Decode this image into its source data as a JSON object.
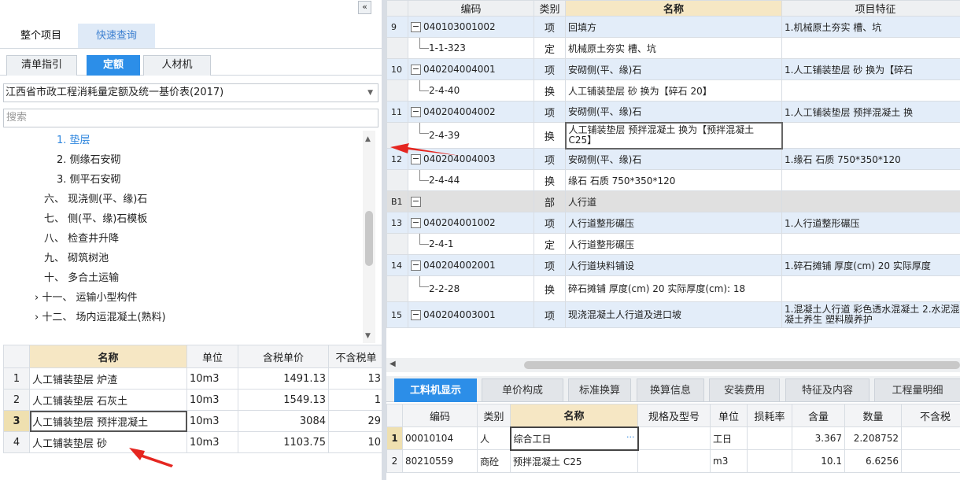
{
  "left_panel": {
    "collapse_glyph": "«",
    "project_tabs": [
      "整个项目",
      "快速查询"
    ],
    "sub_tabs": [
      "清单指引",
      "定额",
      "人材机"
    ],
    "quota_book": "江西省市政工程消耗量定额及统一基价表(2017)",
    "search_placeholder": "搜索",
    "tree": [
      {
        "label": "1. 垫层",
        "indent": 68,
        "selected": true
      },
      {
        "label": "2. 侧缘石安砌",
        "indent": 68
      },
      {
        "label": "3. 侧平石安砌",
        "indent": 68
      },
      {
        "label": "六、 现浇侧(平、缘)石",
        "indent": 52
      },
      {
        "label": "七、 侧(平、缘)石模板",
        "indent": 52
      },
      {
        "label": "八、 检查井升降",
        "indent": 52
      },
      {
        "label": "九、 砌筑树池",
        "indent": 52
      },
      {
        "label": "十、 多合土运输",
        "indent": 52
      },
      {
        "label": "› 十一、 运输小型构件",
        "indent": 40
      },
      {
        "label": "› 十二、 场内运混凝土(熟料)",
        "indent": 40
      }
    ],
    "quota_table": {
      "headers": [
        "名称",
        "单位",
        "含税单价",
        "不含税单"
      ],
      "rows": [
        {
          "no": "1",
          "name": "人工铺装垫层 炉渣",
          "unit": "10m3",
          "price": "1491.13",
          "ex": "13"
        },
        {
          "no": "2",
          "name": "人工铺装垫层 石灰土",
          "unit": "10m3",
          "price": "1549.13",
          "ex": "1"
        },
        {
          "no": "3",
          "name": "人工铺装垫层 预拌混凝土",
          "unit": "10m3",
          "price": "3084",
          "ex": "29"
        },
        {
          "no": "4",
          "name": "人工铺装垫层 砂",
          "unit": "10m3",
          "price": "1103.75",
          "ex": "10"
        }
      ]
    }
  },
  "grid": {
    "headers": [
      "编码",
      "类别",
      "名称",
      "项目特征"
    ],
    "rows": [
      {
        "no": "9",
        "code": "040103001002",
        "type": "项",
        "name": "回填方",
        "feature": "1.机械原土夯实 槽、坑",
        "kind": "xm"
      },
      {
        "no": "",
        "code": "1-1-323",
        "type": "定",
        "name": "机械原土夯实 槽、坑",
        "feature": "",
        "kind": "child"
      },
      {
        "no": "10",
        "code": "040204004001",
        "type": "项",
        "name": "安砌侧(平、缘)石",
        "feature": "1.人工铺装垫层 砂 换为【碎石",
        "kind": "xm"
      },
      {
        "no": "",
        "code": "2-4-40",
        "type": "换",
        "name": "人工铺装垫层 砂 换为【碎石 20】",
        "feature": "",
        "kind": "child"
      },
      {
        "no": "11",
        "code": "040204004002",
        "type": "项",
        "name": "安砌侧(平、缘)石",
        "feature": "1.人工铺装垫层 预拌混凝土 换",
        "kind": "xm"
      },
      {
        "no": "",
        "code": "2-4-39",
        "type": "换",
        "name": "人工铺装垫层 预拌混凝土 换为【预拌混凝土 C25】",
        "feature": "",
        "kind": "child",
        "tall": true,
        "selected": true
      },
      {
        "no": "12",
        "code": "040204004003",
        "type": "项",
        "name": "安砌侧(平、缘)石",
        "feature": "1.缘石 石质 750*350*120",
        "kind": "xm"
      },
      {
        "no": "",
        "code": "2-4-44",
        "type": "换",
        "name": "缘石 石质 750*350*120",
        "feature": "",
        "kind": "child"
      },
      {
        "no": "B1",
        "code": "",
        "type": "部",
        "name": "人行道",
        "feature": "",
        "kind": "bu"
      },
      {
        "no": "13",
        "code": "040204001002",
        "type": "项",
        "name": "人行道整形碾压",
        "feature": "1.人行道整形碾压",
        "kind": "xm"
      },
      {
        "no": "",
        "code": "2-4-1",
        "type": "定",
        "name": "人行道整形碾压",
        "feature": "",
        "kind": "child"
      },
      {
        "no": "14",
        "code": "040204002001",
        "type": "项",
        "name": "人行道块料铺设",
        "feature": "1.碎石摊铺 厚度(cm) 20 实际厚度",
        "kind": "xm"
      },
      {
        "no": "",
        "code": "2-2-28",
        "type": "换",
        "name": "碎石摊铺 厚度(cm) 20 实际厚度(cm): 18",
        "feature": "",
        "kind": "child",
        "tall": true
      },
      {
        "no": "15",
        "code": "040204003001",
        "type": "项",
        "name": "现浇混凝土人行道及进口坡",
        "feature": "1.混凝土人行道 彩色透水混凝土 2.水泥混凝土养生 塑料膜养护",
        "kind": "xm",
        "tall": true
      }
    ]
  },
  "bottom_tabs": [
    "工料机显示",
    "单价构成",
    "标准换算",
    "换算信息",
    "安装费用",
    "特征及内容",
    "工程量明细"
  ],
  "bottom_table": {
    "headers": [
      "编码",
      "类别",
      "名称",
      "规格及型号",
      "单位",
      "损耗率",
      "含量",
      "数量",
      "不含税"
    ],
    "rows": [
      {
        "no": "1",
        "code": "00010104",
        "type": "人",
        "name": "综合工日",
        "more": "···",
        "spec": "",
        "unit": "工日",
        "loss": "",
        "content": "3.367",
        "qty": "2.208752",
        "ex": ""
      },
      {
        "no": "2",
        "code": "80210559",
        "type": "商砼",
        "name": "预拌混凝土 C25",
        "spec": "",
        "unit": "m3",
        "loss": "",
        "content": "10.1",
        "qty": "6.6256",
        "ex": ""
      }
    ]
  },
  "colors": {
    "accent": "#2c8ee8",
    "header_highlight": "#f6e7c4",
    "item_row": "#e3edf9",
    "arrow": "#e52620"
  }
}
